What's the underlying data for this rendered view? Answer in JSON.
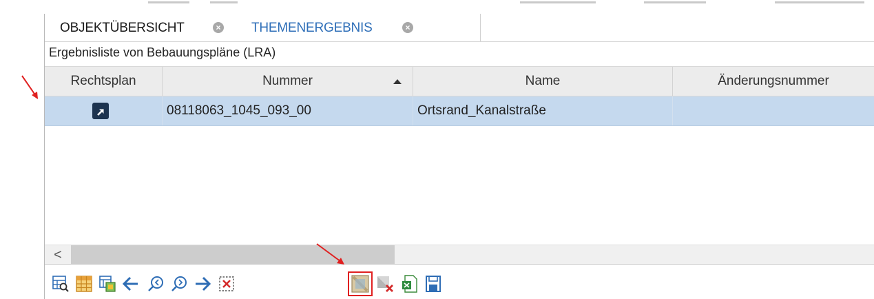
{
  "tabs": {
    "objektuebersicht": "OBJEKTÜBERSICHT",
    "themenergebnis": "THEMENERGEBNIS",
    "close_glyph": "×"
  },
  "result_list_title": "Ergebnisliste von Bebauungspläne (LRA)",
  "grid": {
    "columns": {
      "rechtsplan": "Rechtsplan",
      "nummer": "Nummer",
      "name": "Name",
      "aenderungsnummer": "Änderungsnummer"
    },
    "sort_column": "Nummer",
    "sort_direction": "ascending",
    "rows": [
      {
        "nummer": "08118063_1045_093_00",
        "name": "Ortsrand_Kanalstraße",
        "aenderungsnummer": ""
      }
    ]
  },
  "scrollbar": {
    "left_arrow": "<"
  },
  "toolbar": {
    "icons": [
      "table-search-icon",
      "table-grid-icon",
      "table-layers-icon",
      "arrow-left-icon",
      "zoom-out-icon",
      "zoom-in-icon",
      "arrow-right-icon",
      "clear-selection-icon",
      "map-select-icon",
      "map-deselect-icon",
      "excel-export-icon",
      "save-icon"
    ],
    "highlighted_icon": "map-select-icon"
  },
  "colors": {
    "selected_row": "#c5d9ee",
    "active_tab_link": "#2f6fb8",
    "annotation_red": "#e02020",
    "toolbar_blue": "#2e6db5",
    "grid_orange": "#e8a13a"
  }
}
